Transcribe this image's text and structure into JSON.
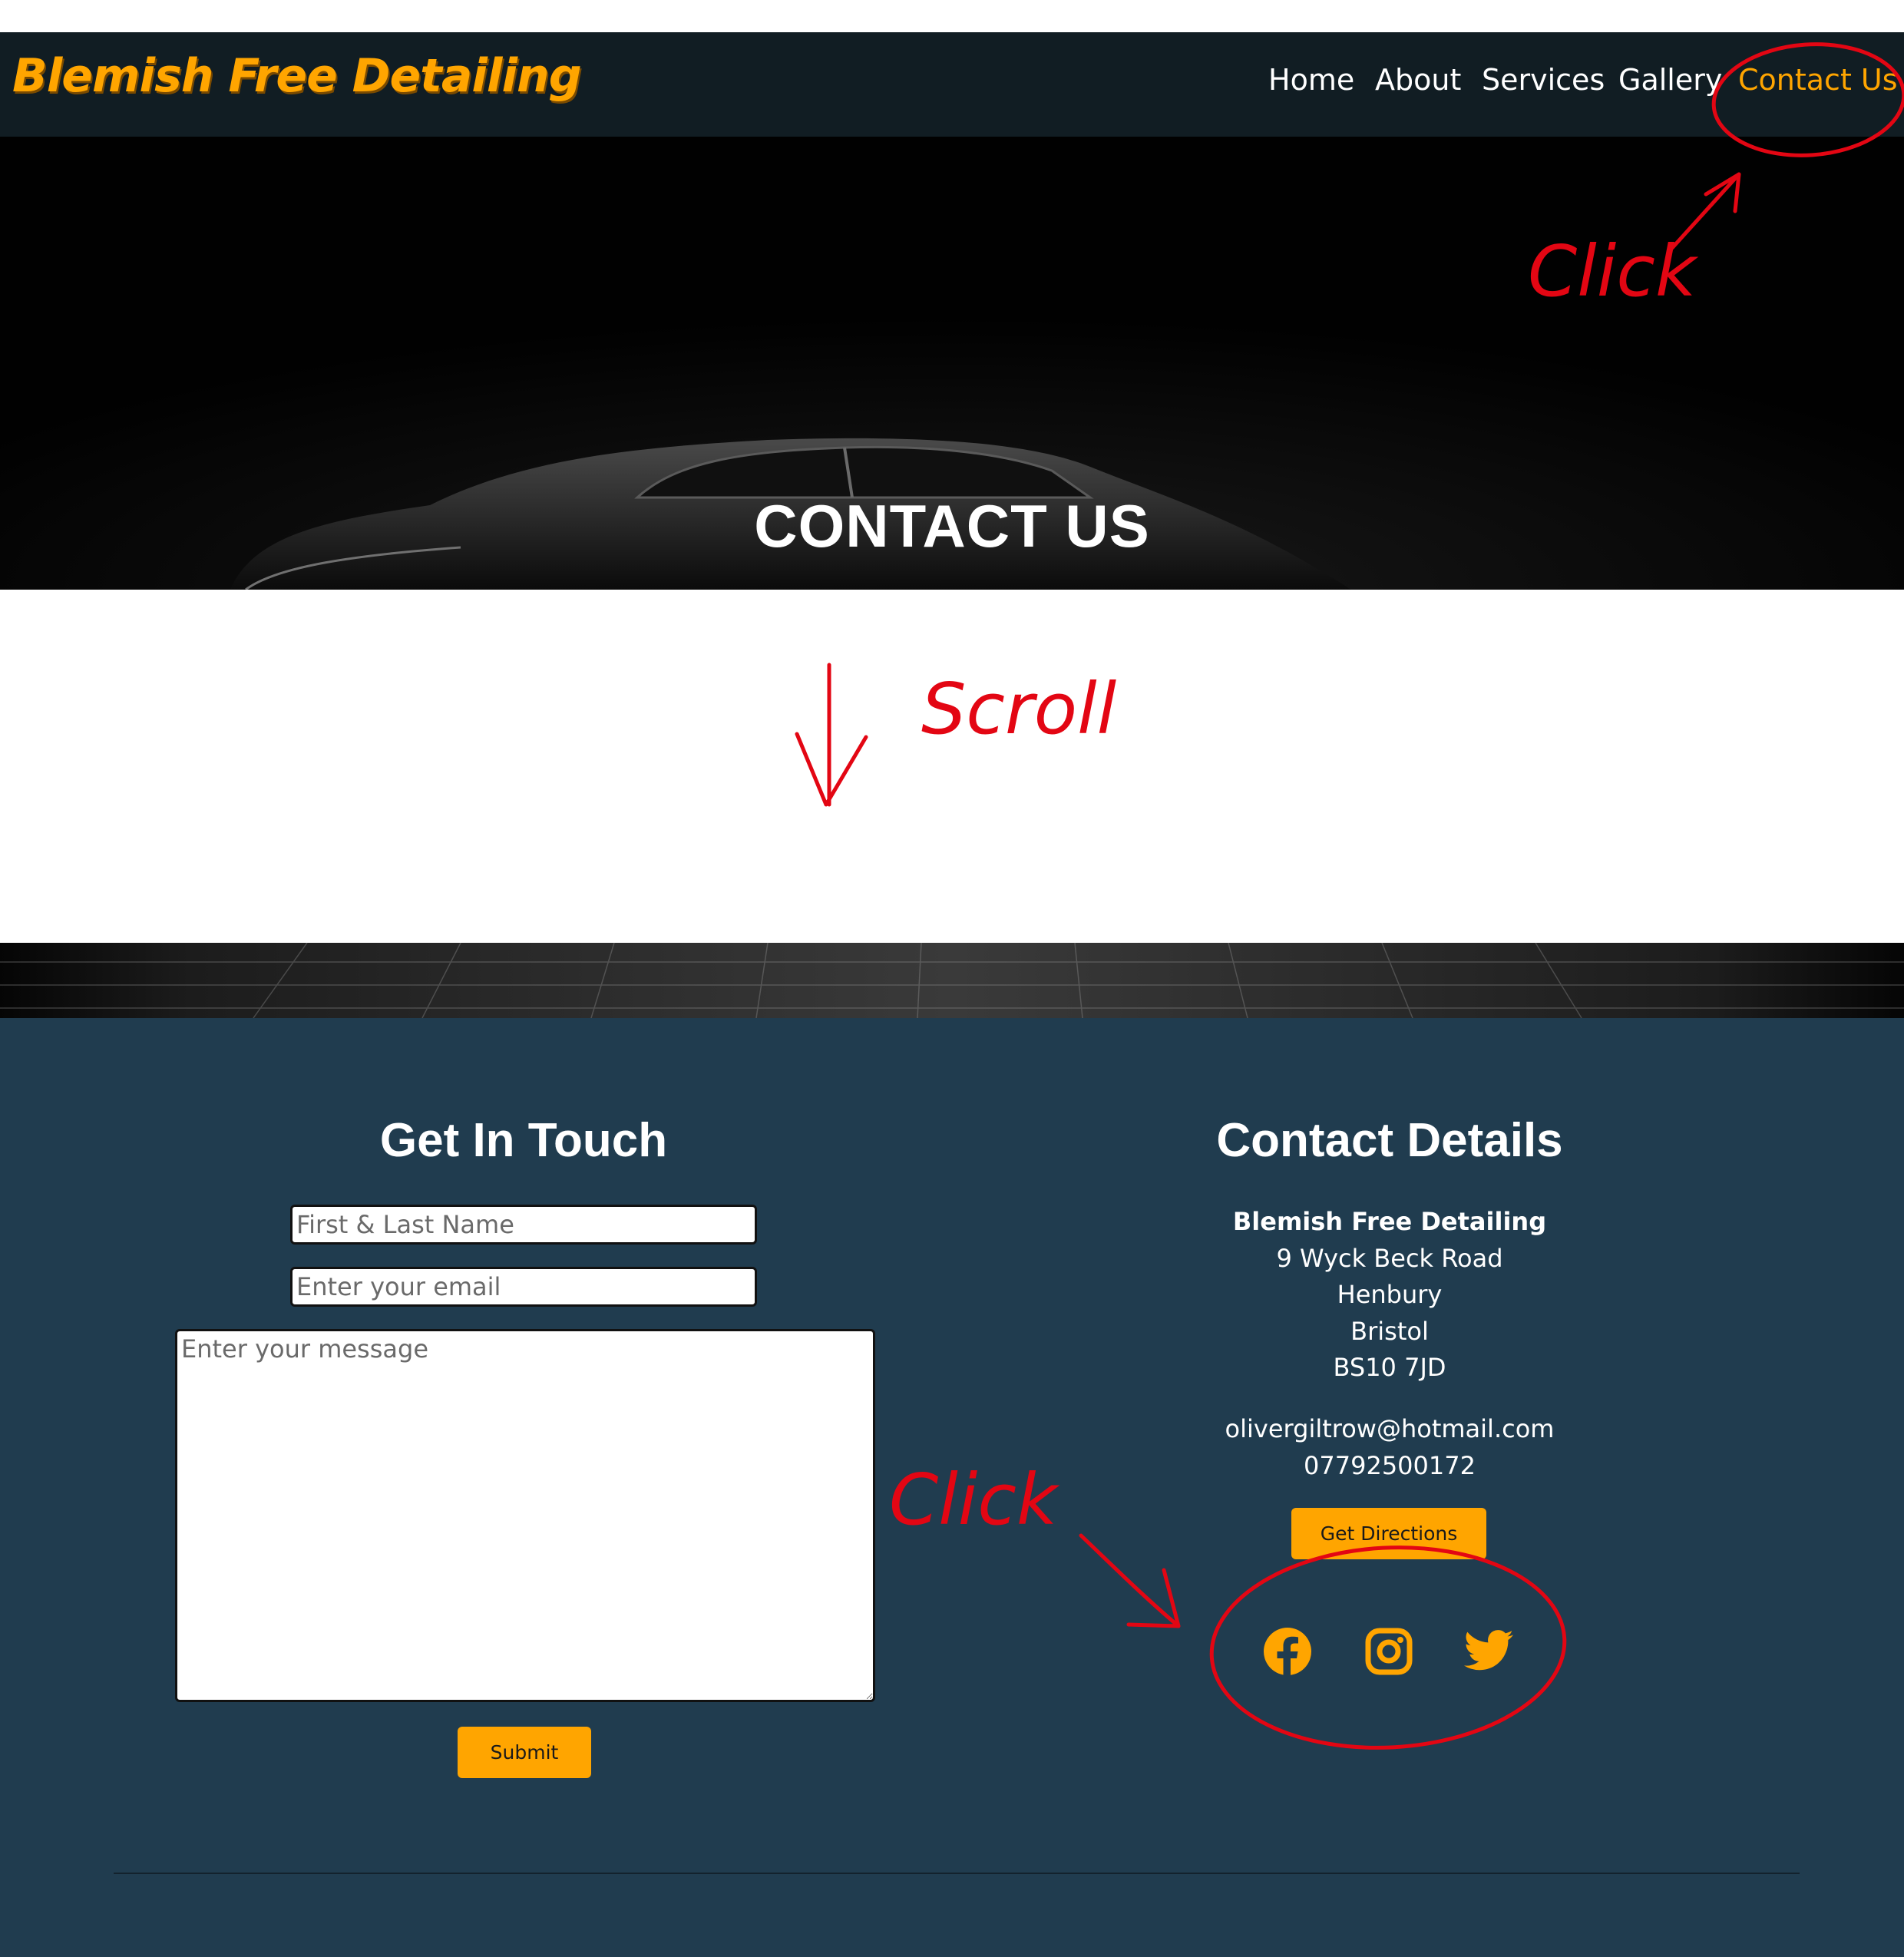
{
  "nav": {
    "brand": "Blemish Free Detailing",
    "links": [
      {
        "label": "Home"
      },
      {
        "label": "About"
      },
      {
        "label": "Services"
      },
      {
        "label": "Gallery"
      },
      {
        "label": "Contact Us"
      }
    ]
  },
  "hero": {
    "title": "CONTACT US"
  },
  "form": {
    "title": "Get In Touch",
    "name_placeholder": "First & Last Name",
    "email_placeholder": "Enter your email",
    "message_placeholder": "Enter your message",
    "submit_label": "Submit"
  },
  "details": {
    "title": "Contact Details",
    "company": "Blemish Free Detailing",
    "address": [
      "9 Wyck Beck Road",
      "Henbury",
      "Bristol",
      "BS10 7JD"
    ],
    "email": "olivergiltrow@hotmail.com",
    "phone": "07792500172",
    "directions_label": "Get Directions"
  },
  "social": [
    {
      "icon": "facebook-icon"
    },
    {
      "icon": "instagram-icon"
    },
    {
      "icon": "twitter-icon"
    }
  ],
  "annotations": {
    "click_top": "Click",
    "scroll": "Scroll",
    "click_bottom": "Click"
  },
  "colors": {
    "accent": "#ffa500",
    "navbar_bg": "#111d23",
    "contact_bg": "#203c4f",
    "annotation": "#e30613"
  }
}
